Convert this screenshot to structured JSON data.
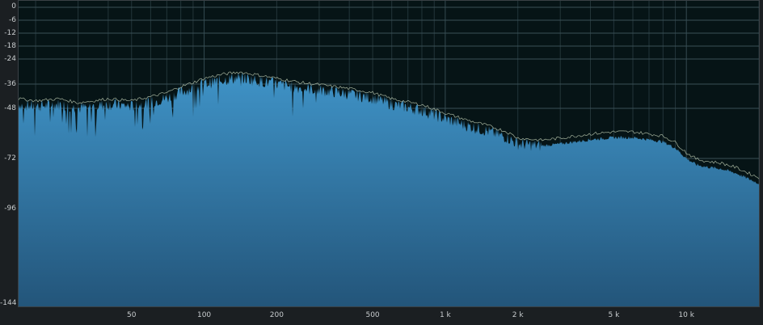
{
  "chart_data": {
    "type": "area",
    "title": "",
    "xlabel": "",
    "ylabel": "",
    "x_scale": "log",
    "xlim": [
      17,
      20000
    ],
    "ylim": [
      -144,
      0
    ],
    "grid": true,
    "legend": "none",
    "y_ticks": [
      "0",
      "-6",
      "-12",
      "-18",
      "-24",
      "-36",
      "-48",
      "-72",
      "-96",
      "-144"
    ],
    "y_tick_values": [
      0,
      -6,
      -12,
      -18,
      -24,
      -36,
      -48,
      -72,
      -96,
      -144
    ],
    "x_ticks": [
      "50",
      "100",
      "200",
      "500",
      "1 k",
      "2 k",
      "5 k",
      "10 k"
    ],
    "x_tick_values": [
      50,
      100,
      200,
      500,
      1000,
      2000,
      5000,
      10000
    ],
    "series": [
      {
        "x": [
          17,
          20,
          25,
          30,
          35,
          40,
          50,
          60,
          70,
          80,
          90,
          100,
          120,
          140,
          160,
          200,
          250,
          300,
          400,
          500,
          600,
          800,
          1000,
          1200,
          1500,
          1800,
          2000,
          2500,
          3000,
          4000,
          5000,
          6000,
          7000,
          8000,
          9000,
          10000,
          11000,
          12000,
          14000,
          16000,
          20000
        ],
        "values": [
          -46,
          -47,
          -46,
          -48,
          -47,
          -46,
          -47,
          -45,
          -43,
          -40,
          -38,
          -36,
          -34,
          -33,
          -34,
          -36,
          -38,
          -39,
          -41,
          -43,
          -46,
          -49,
          -53,
          -56,
          -59,
          -62,
          -65,
          -66,
          -65,
          -63,
          -62,
          -62,
          -63,
          -64,
          -67,
          -72,
          -75,
          -76,
          -77,
          -79,
          -84
        ]
      }
    ],
    "colors": {
      "plot_background": "#061416",
      "fill_top": "#3f93c7",
      "fill_bottom": "#23557a",
      "peak_line": "#d8e6c8",
      "grid": "#3a5057"
    }
  }
}
